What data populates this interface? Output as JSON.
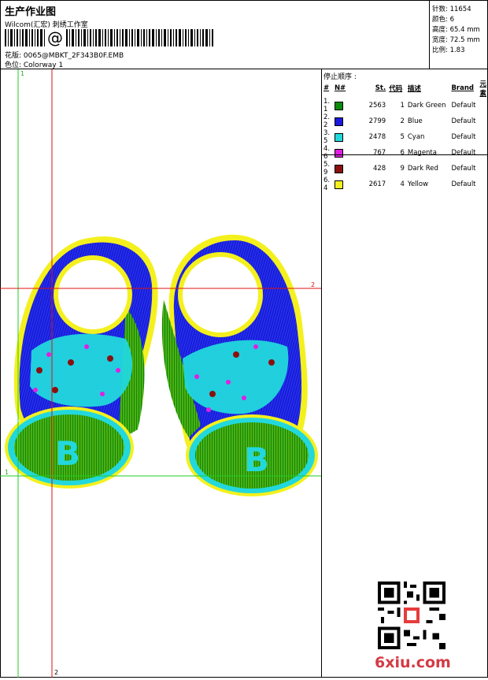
{
  "header": {
    "title": "生产作业图",
    "company": "Wilcom(汇宏) 刺绣工作室",
    "design_line": "花版:  0065@MBKT_2F343B0F.EMB",
    "colorway_line": "色位:  Colorway 1"
  },
  "stats": {
    "stitches": "针数: 11654",
    "colors": "颜色: 6",
    "height": "高度: 65.4 mm",
    "width": "宽度: 72.5 mm",
    "scale": "比例: 1.83"
  },
  "sequence": {
    "title": "停止顺序 :",
    "headers": [
      "#",
      "N#",
      "St.",
      "代码",
      "描述",
      "Brand",
      "元素"
    ],
    "rows": [
      {
        "idx": "1. 1",
        "color": "#0a8a0a",
        "stitches": "2563",
        "code": "1",
        "desc": "Dark Green",
        "brand": "Default"
      },
      {
        "idx": "2. 2",
        "color": "#1a1adc",
        "stitches": "2799",
        "code": "2",
        "desc": "Blue",
        "brand": "Default"
      },
      {
        "idx": "3. 5",
        "color": "#22d8dc",
        "stitches": "2478",
        "code": "5",
        "desc": "Cyan",
        "brand": "Default"
      },
      {
        "idx": "4. 6",
        "color": "#e21ee2",
        "stitches": "767",
        "code": "6",
        "desc": "Magenta",
        "brand": "Default"
      },
      {
        "idx": "5. 9",
        "color": "#8a1010",
        "stitches": "428",
        "code": "9",
        "desc": "Dark Red",
        "brand": "Default"
      },
      {
        "idx": "6. 4",
        "color": "#f4f01e",
        "stitches": "2617",
        "code": "4",
        "desc": "Yellow",
        "brand": "Default"
      }
    ]
  },
  "guides": {
    "v1": "1",
    "v2": "2",
    "h1": "1",
    "h2": "2"
  },
  "design_letters": {
    "left": "B",
    "right": "B"
  },
  "watermark": "6xiu.com",
  "colors": {
    "dark_green": "#0a8a0a",
    "blue": "#1a1adc",
    "cyan": "#22d8dc",
    "magenta": "#e21ee2",
    "dark_red": "#8a1010",
    "yellow": "#f4f01e",
    "green_guide": "#22cc22",
    "red_guide": "#dd1111"
  }
}
